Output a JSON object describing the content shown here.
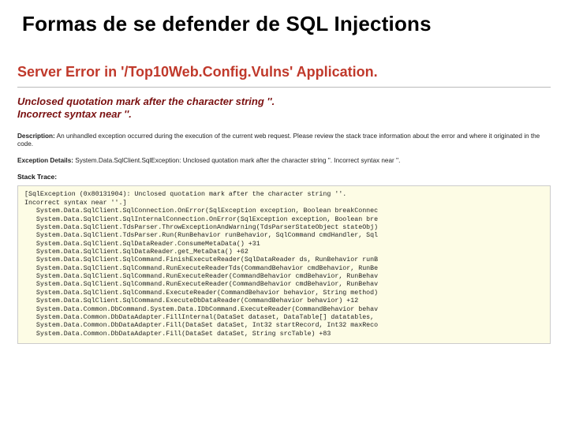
{
  "slide": {
    "title": "Formas de se defender de SQL Injections"
  },
  "error": {
    "heading": "Server Error in '/Top10Web.Config.Vulns' Application.",
    "message_line1": "Unclosed quotation mark after the character string ''.",
    "message_line2": "Incorrect syntax near ''.",
    "description_label": "Description:",
    "description_text": "An unhandled exception occurred during the execution of the current web request. Please review the stack trace information about the error and where it originated in the code.",
    "details_label": "Exception Details:",
    "details_text": "System.Data.SqlClient.SqlException: Unclosed quotation mark after the character string ''. Incorrect syntax near ''.",
    "stack_label": "Stack Trace:",
    "stack_trace": "[SqlException (0x80131904): Unclosed quotation mark after the character string ''.\nIncorrect syntax near ''.]\n   System.Data.SqlClient.SqlConnection.OnError(SqlException exception, Boolean breakConnec\n   System.Data.SqlClient.SqlInternalConnection.OnError(SqlException exception, Boolean bre\n   System.Data.SqlClient.TdsParser.ThrowExceptionAndWarning(TdsParserStateObject stateObj)\n   System.Data.SqlClient.TdsParser.Run(RunBehavior runBehavior, SqlCommand cmdHandler, Sql\n   System.Data.SqlClient.SqlDataReader.ConsumeMetaData() +31\n   System.Data.SqlClient.SqlDataReader.get_MetaData() +62\n   System.Data.SqlClient.SqlCommand.FinishExecuteReader(SqlDataReader ds, RunBehavior runB\n   System.Data.SqlClient.SqlCommand.RunExecuteReaderTds(CommandBehavior cmdBehavior, RunBe\n   System.Data.SqlClient.SqlCommand.RunExecuteReader(CommandBehavior cmdBehavior, RunBehav\n   System.Data.SqlClient.SqlCommand.RunExecuteReader(CommandBehavior cmdBehavior, RunBehav\n   System.Data.SqlClient.SqlCommand.ExecuteReader(CommandBehavior behavior, String method)\n   System.Data.SqlClient.SqlCommand.ExecuteDbDataReader(CommandBehavior behavior) +12\n   System.Data.Common.DbCommand.System.Data.IDbCommand.ExecuteReader(CommandBehavior behav\n   System.Data.Common.DbDataAdapter.FillInternal(DataSet dataset, DataTable[] datatables,\n   System.Data.Common.DbDataAdapter.Fill(DataSet dataSet, Int32 startRecord, Int32 maxReco\n   System.Data.Common.DbDataAdapter.Fill(DataSet dataSet, String srcTable) +83"
  }
}
